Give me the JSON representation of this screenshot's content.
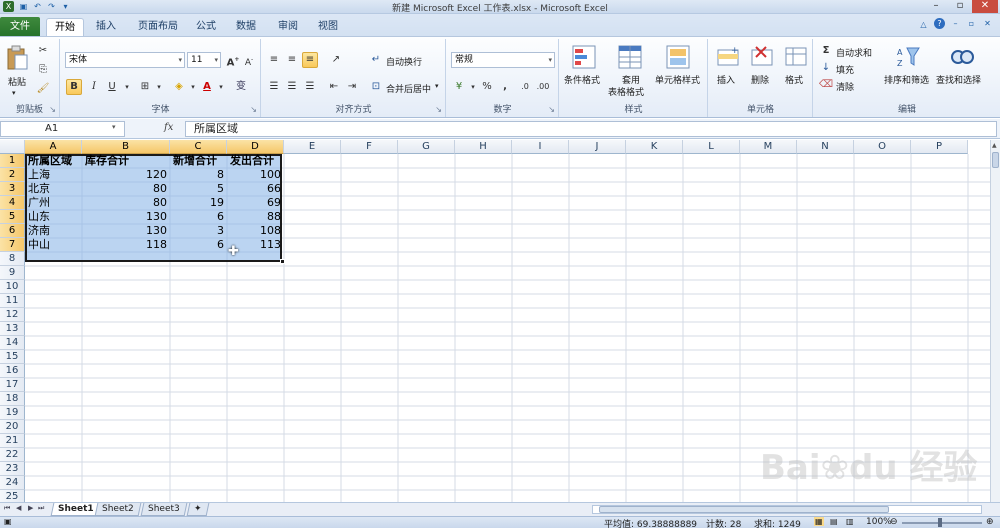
{
  "window": {
    "title": "新建 Microsoft Excel 工作表.xlsx - Microsoft Excel"
  },
  "tabs": {
    "file": "文件",
    "items": [
      "开始",
      "插入",
      "页面布局",
      "公式",
      "数据",
      "审阅",
      "视图"
    ]
  },
  "ribbon": {
    "clipboard": {
      "label": "剪贴板",
      "paste": "粘贴"
    },
    "font": {
      "label": "字体",
      "name": "宋体",
      "size": "11",
      "bold": "B",
      "italic": "I",
      "underline": "U"
    },
    "align": {
      "label": "对齐方式",
      "wrap": "自动换行",
      "merge": "合并后居中"
    },
    "number": {
      "label": "数字",
      "format": "常规",
      "percent": "%",
      "comma": ","
    },
    "styles": {
      "label": "样式",
      "cond": "条件格式",
      "table1": "套用",
      "table2": "表格格式",
      "cell": "单元格样式"
    },
    "cells": {
      "label": "单元格",
      "insert": "插入",
      "delete": "删除",
      "format": "格式"
    },
    "edit": {
      "label": "编辑",
      "autosum": "自动求和",
      "fill": "填充",
      "clear": "清除",
      "sort": "排序和筛选",
      "find": "查找和选择"
    }
  },
  "formula": {
    "namebox": "A1",
    "fx": "fx",
    "content": "所属区域"
  },
  "grid": {
    "columns": [
      "A",
      "B",
      "C",
      "D",
      "E",
      "F",
      "G",
      "H",
      "I",
      "J",
      "K",
      "L",
      "M",
      "N",
      "O",
      "P"
    ],
    "rows": [
      "1",
      "2",
      "3",
      "4",
      "5",
      "6",
      "7",
      "8",
      "9",
      "10",
      "11",
      "12",
      "13",
      "14",
      "15",
      "16",
      "17",
      "18",
      "19",
      "20",
      "21",
      "22",
      "23",
      "24",
      "25"
    ],
    "headers": [
      "所属区域",
      "库存合计",
      "新增合计",
      "发出合计"
    ],
    "data": [
      [
        "上海",
        "120",
        "8",
        "100"
      ],
      [
        "北京",
        "80",
        "5",
        "66"
      ],
      [
        "广州",
        "80",
        "19",
        "69"
      ],
      [
        "山东",
        "130",
        "6",
        "88"
      ],
      [
        "济南",
        "130",
        "3",
        "108"
      ],
      [
        "中山",
        "118",
        "6",
        "113"
      ]
    ]
  },
  "sheets": [
    "Sheet1",
    "Sheet2",
    "Sheet3"
  ],
  "status": {
    "average": "平均值: 69.38888889",
    "count": "计数: 28",
    "sum": "求和: 1249",
    "zoom": "100%"
  }
}
